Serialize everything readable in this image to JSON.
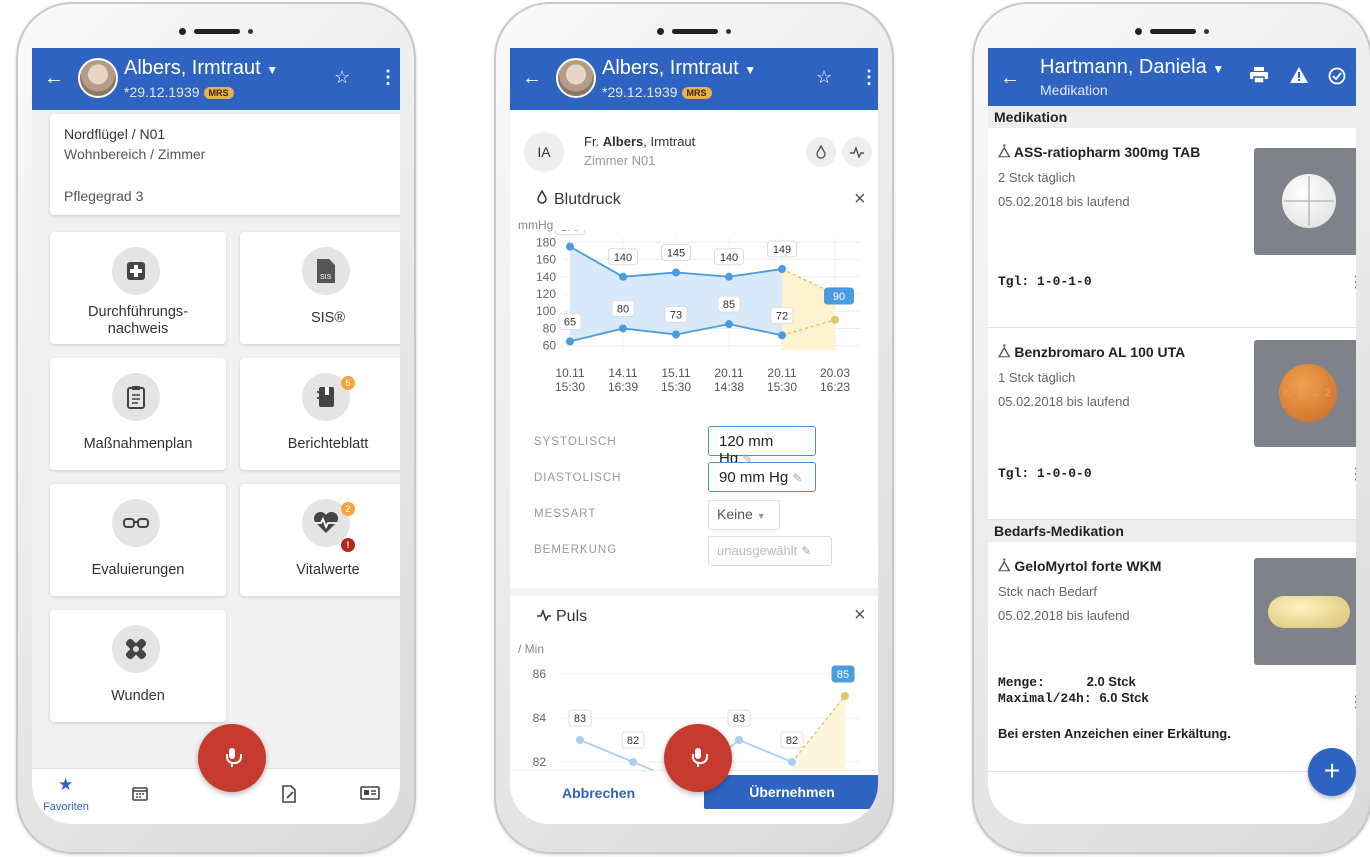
{
  "phone1": {
    "header": {
      "name": "Albers, Irmtraut",
      "dob": "*29.12.1939",
      "badge": "MRS"
    },
    "location": {
      "line1": "Nordflügel / N01",
      "line2": "Wohnbereich / Zimmer",
      "care_level_label": "Pflegegrad",
      "care_level": "3"
    },
    "tiles": [
      {
        "label1": "Durchführungs-",
        "label2": "nachweis"
      },
      {
        "label1": "SIS®",
        "icon_text": "SIS"
      },
      {
        "label1": "Maßnahmenplan"
      },
      {
        "label1": "Berichteblatt",
        "badge": "5"
      },
      {
        "label1": "Evaluierungen"
      },
      {
        "label1": "Vitalwerte",
        "badge": "2",
        "alert": "!"
      },
      {
        "label1": "Wunden"
      }
    ],
    "nav": {
      "favorites_label": "Favoriten"
    }
  },
  "phone2": {
    "header": {
      "name": "Albers, Irmtraut",
      "dob": "*29.12.1939",
      "badge": "MRS"
    },
    "patient": {
      "initials": "IA",
      "salutation": "Fr.",
      "surname": "Albers",
      "firstname": ", Irmtraut",
      "room": "Zimmer N01"
    },
    "bp": {
      "title": "Blutdruck",
      "unit": "mmHg"
    },
    "fields": {
      "systolic_label": "SYSTOLISCH",
      "systolic_value": "120 mm Hg",
      "diastolic_label": "DIASTOLISCH",
      "diastolic_value": "90 mm Hg",
      "method_label": "MESSART",
      "method_value": "Keine",
      "remark_label": "BEMERKUNG",
      "remark_value": "unausgewählt"
    },
    "pulse": {
      "title": "Puls",
      "unit": "/ Min"
    },
    "buttons": {
      "cancel": "Abbrechen",
      "apply": "Übernehmen"
    }
  },
  "phone3": {
    "header": {
      "name": "Hartmann, Daniela",
      "subtitle": "Medikation"
    },
    "section1": "Medikation",
    "section2": "Bedarfs-Medikation",
    "meds": [
      {
        "name": "ASS-ratiopharm 300mg TAB",
        "dose": "2 Stck täglich",
        "period": "05.02.2018 bis laufend",
        "schedule": "Tgl: 1-0-1-0"
      },
      {
        "name": "Benzbromaro  AL 100 UTA",
        "dose": "1 Stck täglich",
        "period": "05.02.2018 bis laufend",
        "schedule": "Tgl: 1-0-0-0",
        "pill_text": "K E 1 2"
      },
      {
        "name": "GeloMyrtol forte WKM",
        "dose": "Stck nach Bedarf",
        "period": "05.02.2018 bis laufend",
        "amount_label": "Menge:",
        "amount": "2.0 Stck",
        "max_label": "Maximal/24h:",
        "max": "6.0 Stck",
        "note": "Bei ersten Anzeichen einer Erkältung."
      }
    ]
  },
  "chart_data": [
    {
      "type": "line",
      "title": "Blutdruck",
      "ylabel": "mmHg",
      "x": [
        "10.11 15:30",
        "14.11 16:39",
        "15.11 15:30",
        "20.11 14:38",
        "20.11 15:30",
        "20.03 16:23"
      ],
      "yticks": [
        180,
        160,
        140,
        120,
        100,
        80,
        60
      ],
      "ylim": [
        55,
        185
      ],
      "series": [
        {
          "values": [
            175,
            140,
            145,
            140,
            149,
            120
          ],
          "color": "#4a9be0"
        },
        {
          "values": [
            65,
            80,
            73,
            85,
            72,
            90
          ],
          "color": "#4a9be0"
        }
      ],
      "last_point_color": "#e0c46a"
    },
    {
      "type": "line",
      "title": "Puls",
      "ylabel": "/ Min",
      "yticks": [
        86,
        84,
        82
      ],
      "ylim": [
        81,
        87
      ],
      "series": [
        {
          "values": [
            83,
            82,
            81,
            83,
            82,
            85
          ],
          "color": "#4a9be0"
        }
      ]
    }
  ],
  "colors": {
    "primary": "#2f63c2",
    "fab": "#c73a2f",
    "badge": "#f4a53c",
    "chart_blue": "#4a9be0",
    "chart_yellow": "#e0c46a"
  }
}
